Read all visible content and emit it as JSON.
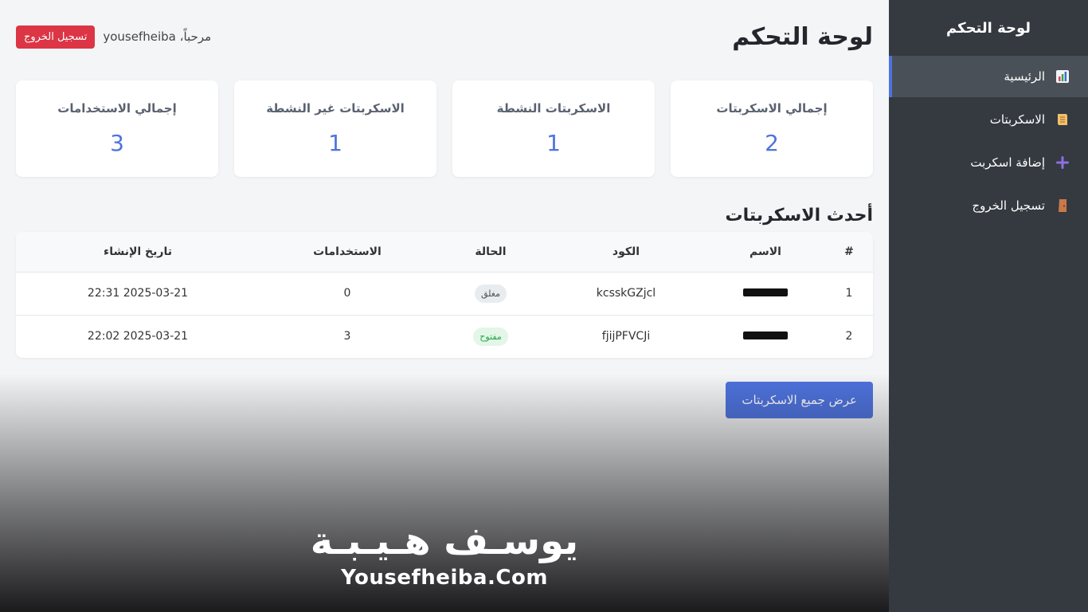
{
  "sidebar": {
    "title": "لوحة التحكم",
    "items": [
      {
        "label": "الرئيسية",
        "icon": "chart-icon",
        "active": true
      },
      {
        "label": "الاسكربتات",
        "icon": "scroll-icon",
        "active": false
      },
      {
        "label": "إضافة اسكربت",
        "icon": "plus-icon",
        "active": false
      },
      {
        "label": "تسجيل الخروج",
        "icon": "door-icon",
        "active": false
      }
    ]
  },
  "header": {
    "title": "لوحة التحكم",
    "welcome": "مرحباً، yousefheiba",
    "logout_label": "تسجيل الخروج"
  },
  "stats": [
    {
      "label": "إجمالي الاسكربتات",
      "value": "2"
    },
    {
      "label": "الاسكربتات النشطة",
      "value": "1"
    },
    {
      "label": "الاسكربتات غير النشطة",
      "value": "1"
    },
    {
      "label": "إجمالي الاستخدامات",
      "value": "3"
    }
  ],
  "recent": {
    "title": "أحدث الاسكربتات",
    "columns": [
      "#",
      "الاسم",
      "الكود",
      "الحالة",
      "الاستخدامات",
      "تاريخ الإنشاء"
    ],
    "rows": [
      {
        "idx": "1",
        "code": "kcsskGZjcl",
        "status": "مغلق",
        "status_type": "closed",
        "uses": "0",
        "created": "2025-03-21 22:31"
      },
      {
        "idx": "2",
        "code": "fjijPFVCJi",
        "status": "مفتوح",
        "status_type": "open",
        "uses": "3",
        "created": "2025-03-21 22:02"
      }
    ]
  },
  "view_all_label": "عرض جميع الاسكربتات",
  "watermark": {
    "arabic": "يوسـف هـيـبـة",
    "english": "Yousefheiba.Com"
  },
  "colors": {
    "sidebar_bg": "#343a40",
    "accent": "#4e73df",
    "danger": "#dc3545",
    "success": "#28a745"
  }
}
